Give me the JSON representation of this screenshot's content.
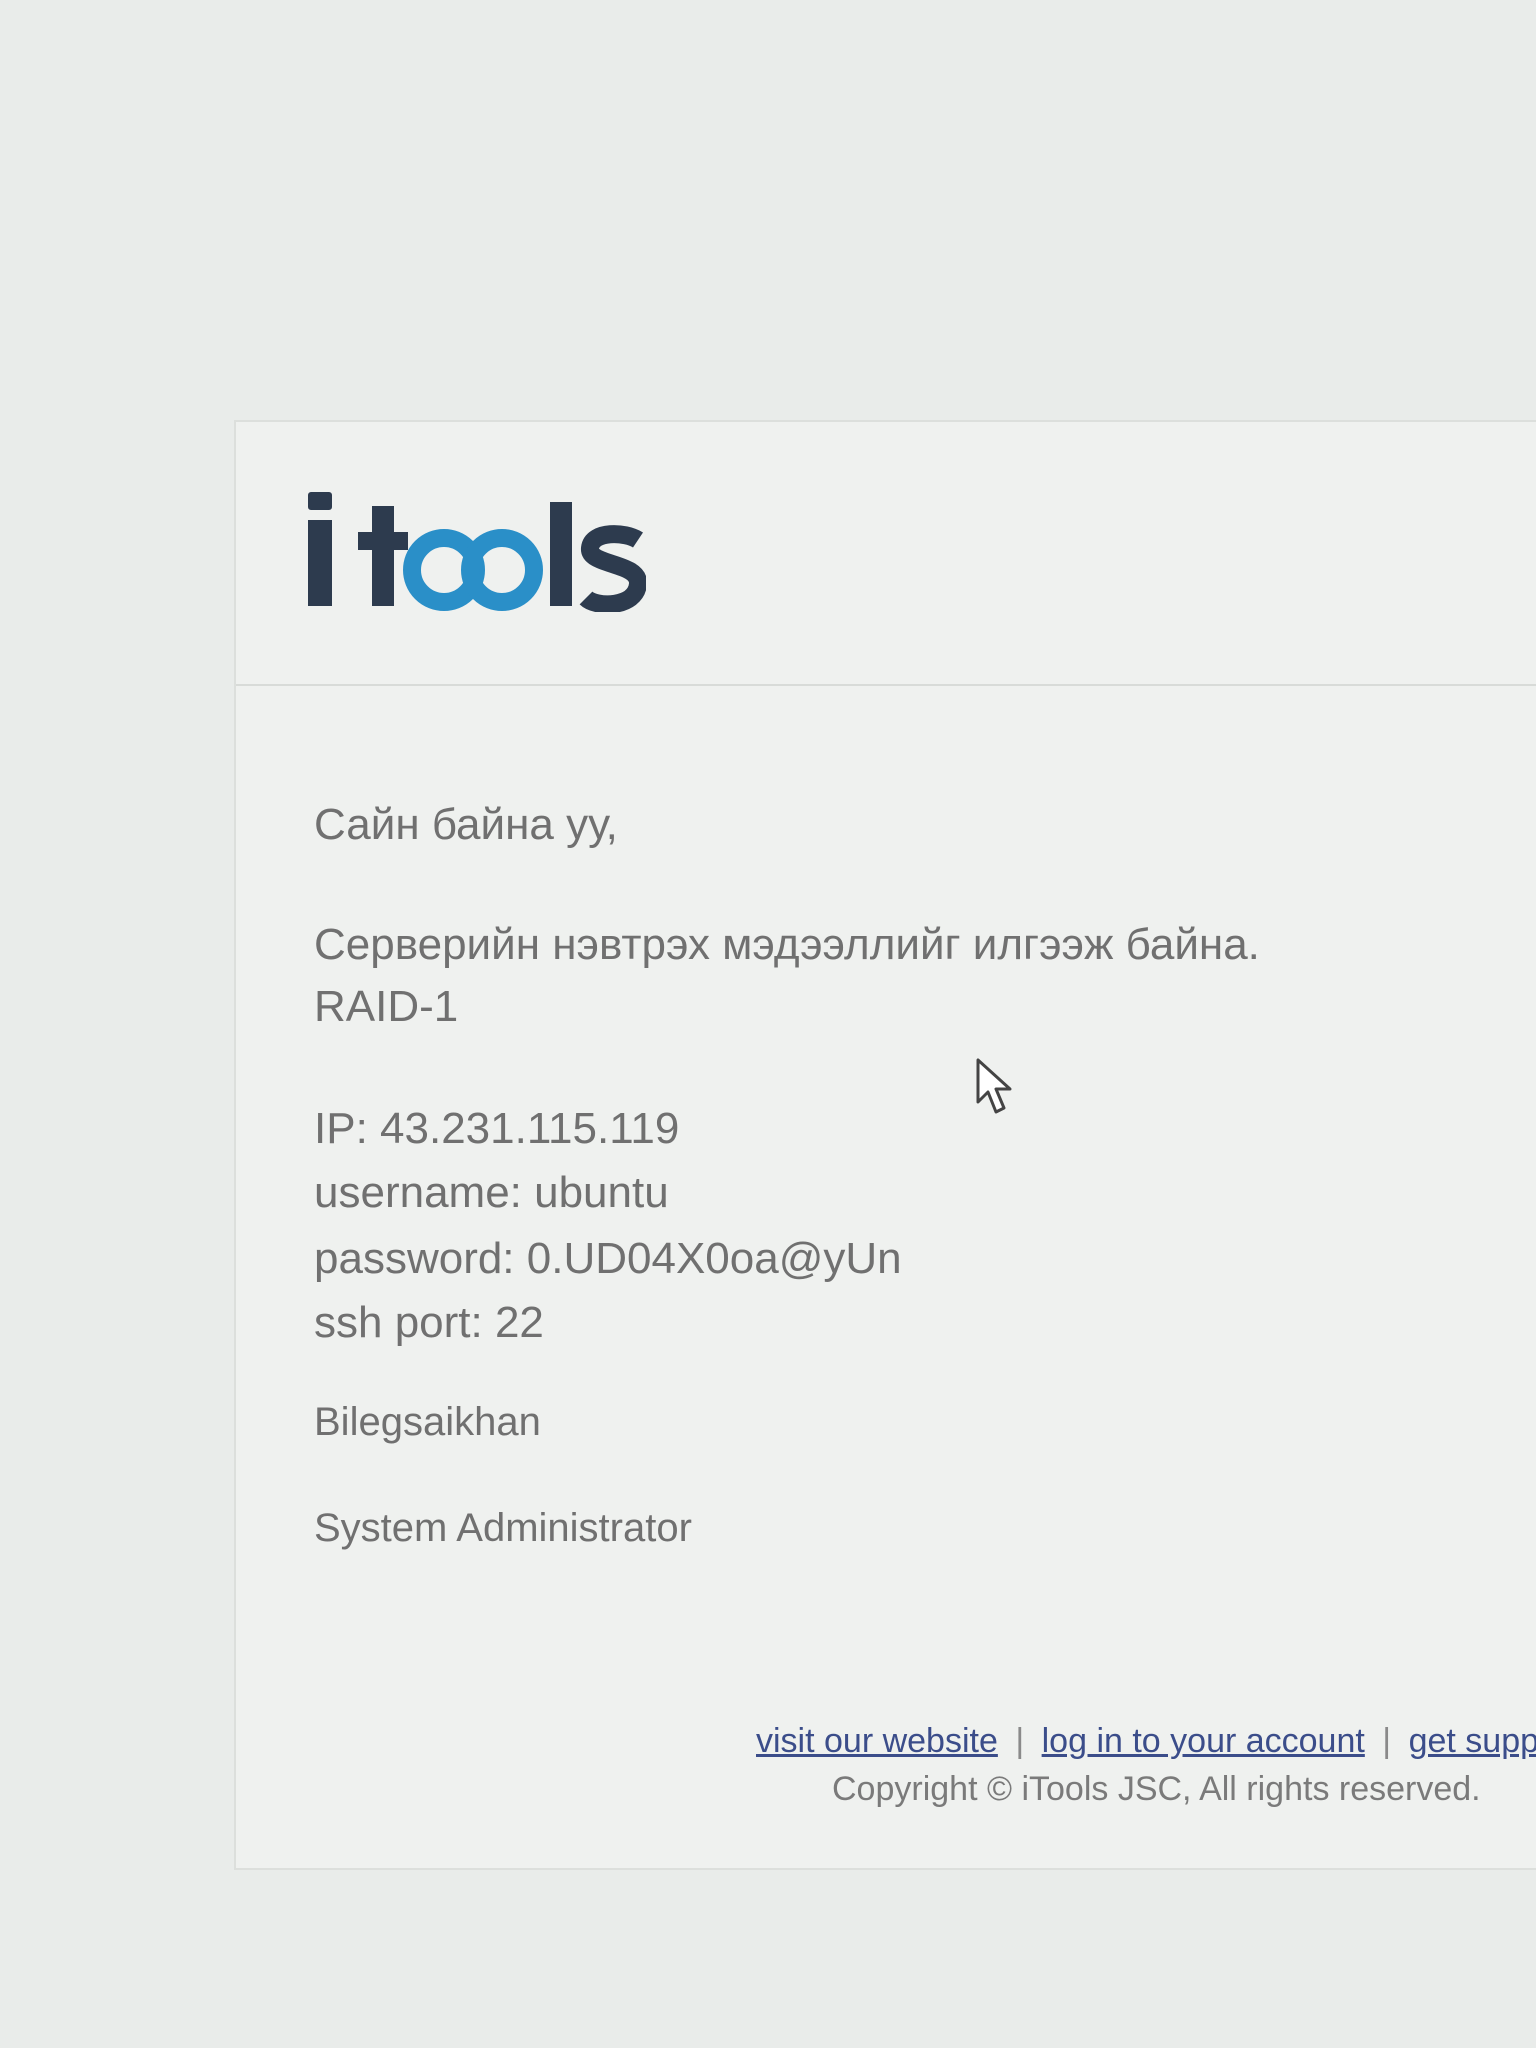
{
  "logo": {
    "text": "itools",
    "dark_color": "#2d3b4e",
    "accent_color": "#2a8fc8"
  },
  "message": {
    "greeting": "Сайн байна уу,",
    "intro": "Серверийн нэвтрэх мэдээллийг илгээж байна.",
    "raid": "RAID-1",
    "ip": "IP: 43.231.115.119",
    "username": "username: ubuntu",
    "password": "password: 0.UD04X0oa@yUn",
    "ssh_port": "ssh port: 22",
    "signature_name": "Bilegsaikhan",
    "signature_title": "System Administrator"
  },
  "footer": {
    "link_website": "visit our website",
    "link_account": "log in to your account",
    "link_support": "get supp",
    "separator": "|",
    "copyright": "Copyright © iTools JSC, All rights reserved."
  },
  "icons": {
    "cursor": "mouse-pointer-icon"
  }
}
